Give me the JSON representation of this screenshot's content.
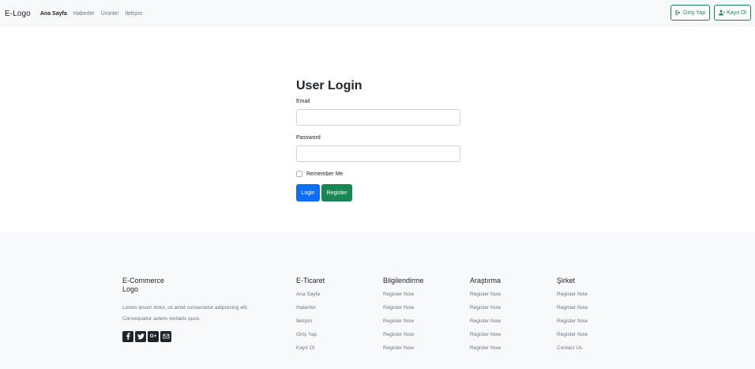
{
  "navbar": {
    "brand": "E-Logo",
    "links": [
      "Ana Sayfa",
      "Haberler",
      "Ürünler",
      "İletişim"
    ],
    "login_button": "Giriş Yap",
    "register_button": "Kayıt Ol"
  },
  "login": {
    "title": "User Login",
    "email_label": "Email",
    "password_label": "Password",
    "remember_label": "Remember Me",
    "login_button": "Login",
    "register_button": "Register"
  },
  "footer": {
    "brand_title_line1": "E-Commerce",
    "brand_title_line2": "Logo",
    "description": "Lorem ipsum dolor, sit amet consectetur adipisicing elit. Consequatur autem veritatis quos.",
    "social_icons": [
      "facebook-icon",
      "twitter-icon",
      "google-plus-icon",
      "envelope-icon"
    ],
    "google_plus_text": "G+",
    "columns": [
      {
        "title": "E-Ticaret",
        "items": [
          "Ana Sayfa",
          "Haberler",
          "İletişim",
          "Giriş Yap",
          "Kayıt Ol"
        ]
      },
      {
        "title": "Bilgilendirme",
        "items": [
          "Register Now",
          "Register Now",
          "Register Now",
          "Register Now",
          "Register Now"
        ]
      },
      {
        "title": "Araştırma",
        "items": [
          "Register Now",
          "Register Now",
          "Register Now",
          "Register Now",
          "Register Now"
        ]
      },
      {
        "title": "Şirket",
        "items": [
          "Register Now",
          "Register Now",
          "Register Now",
          "Register Now",
          "Contact Us"
        ]
      }
    ]
  },
  "colors": {
    "primary": "#0d6efd",
    "success": "#198754",
    "light_bg": "#f8f9fa",
    "muted_text": "#6c757d"
  }
}
